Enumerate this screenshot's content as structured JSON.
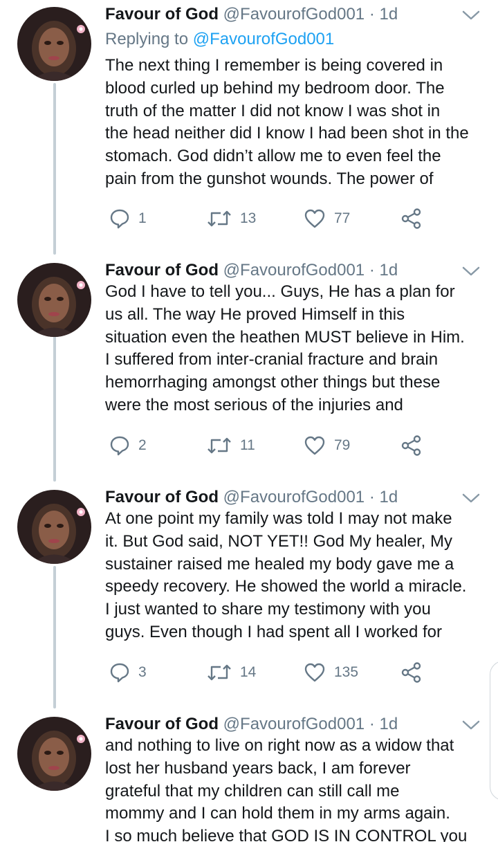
{
  "tweets": [
    {
      "name": "Favour of God",
      "handle": "@FavourofGod001",
      "dot": "·",
      "time": "1d",
      "replying_label": "Replying to",
      "replying_handle": "@FavourofGod001",
      "text": "The next thing I remember is being covered in\nblood curled up behind my bedroom door. The\ntruth of the matter I did not know I was shot in\nthe head neither did I know I had been shot in the\nstomach. God didn’t allow me to even feel the\npain from the gunshot wounds. The power of",
      "replies": "1",
      "retweets": "13",
      "likes": "77"
    },
    {
      "name": "Favour of God",
      "handle": "@FavourofGod001",
      "dot": "·",
      "time": "1d",
      "text": "God I have to tell you... Guys, He has a plan for\nus all. The way He proved Himself in this\nsituation even the heathen MUST believe in Him.\nI suffered from inter-cranial fracture and brain\nhemorrhaging amongst other things but these\nwere the most serious of the injuries and",
      "replies": "2",
      "retweets": "11",
      "likes": "79"
    },
    {
      "name": "Favour of God",
      "handle": "@FavourofGod001",
      "dot": "·",
      "time": "1d",
      "text": "At one point my family was told I may not make\nit. But God said, NOT YET!! God My healer, My\nsustainer raised me healed my body gave me a\nspeedy recovery. He showed the world a miracle.\nI just wanted to share my testimony with you\nguys. Even though I had spent all I worked for",
      "replies": "3",
      "retweets": "14",
      "likes": "135"
    },
    {
      "name": "Favour of God",
      "handle": "@FavourofGod001",
      "dot": "·",
      "time": "1d",
      "text": "and nothing to live on right now as a widow that\nlost her husband years back, I am forever\ngrateful that my children can still call me\nmommy and I can hold them in my arms again.\nI so much believe that GOD IS IN CONTROL you"
    }
  ],
  "icons": {
    "reply": "reply-icon",
    "retweet": "retweet-icon",
    "like": "heart-icon",
    "share": "share-icon",
    "more": "chevron-down-icon"
  },
  "colors": {
    "text": "#14171a",
    "secondary": "#657786",
    "link": "#1da1f2",
    "thread_line": "#c4cfd6"
  }
}
